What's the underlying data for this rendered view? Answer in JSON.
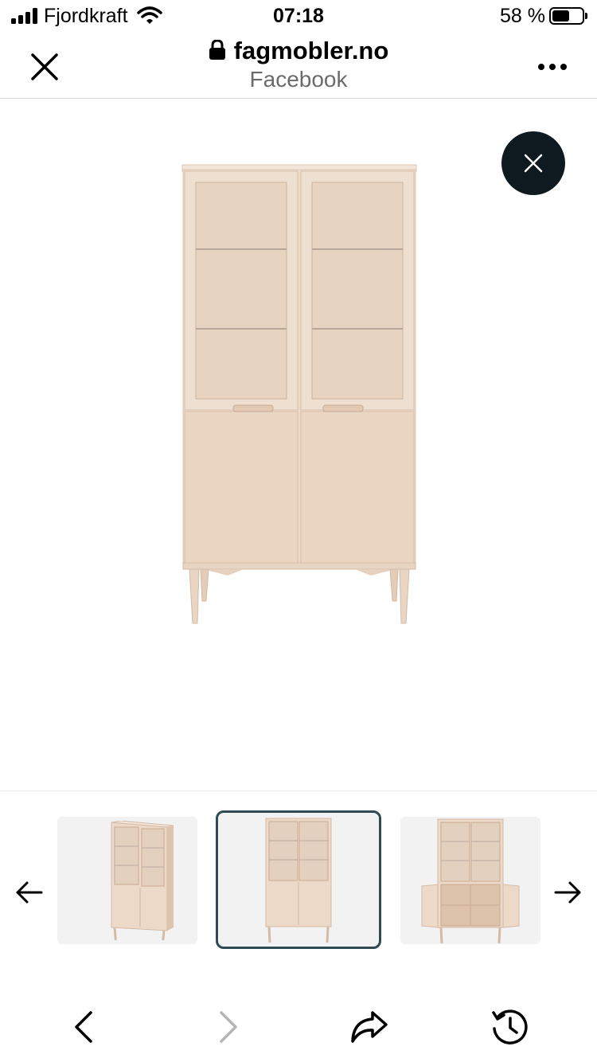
{
  "status_bar": {
    "carrier": "Fjordkraft",
    "time": "07:18",
    "battery": "58 %",
    "battery_level": 0.58,
    "icons": [
      "signal-icon",
      "wifi-icon",
      "battery-icon"
    ]
  },
  "browser": {
    "domain": "fagmobler.no",
    "subtitle": "Facebook",
    "icons": [
      "close-icon",
      "lock-icon",
      "more-icon"
    ]
  },
  "viewer": {
    "main_image": "glass-door-cabinet",
    "close_icon": "close-icon"
  },
  "gallery": {
    "thumbnails": [
      {
        "image": "cabinet-angled",
        "selected": false
      },
      {
        "image": "cabinet-front",
        "selected": true
      },
      {
        "image": "cabinet-open",
        "selected": false
      }
    ],
    "prev_icon": "arrow-left-icon",
    "next_icon": "arrow-right-icon"
  },
  "toolbar": {
    "icons": [
      "back-icon",
      "forward-icon",
      "share-icon",
      "history-icon"
    ],
    "forward_disabled": true
  },
  "colors": {
    "wood": "#ecd9c8",
    "wood_dark": "#dcc4b0",
    "close_button": "#0f1a20",
    "selected_border": "#2f4a55",
    "subtitle": "#6b6b6b"
  }
}
